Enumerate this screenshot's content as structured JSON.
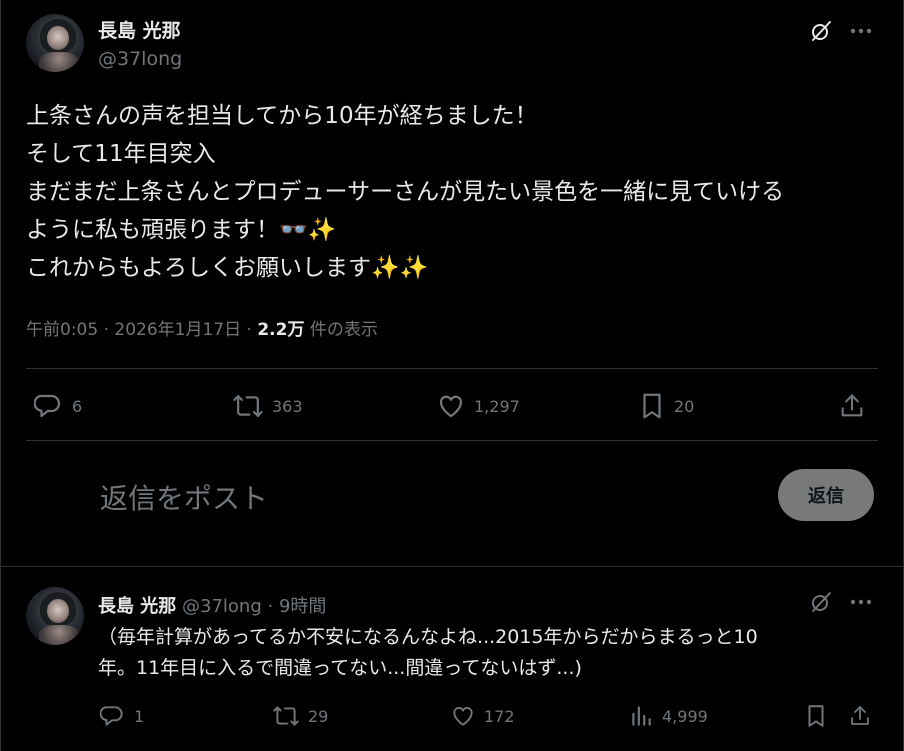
{
  "main_post": {
    "author_name": "長島 光那",
    "author_handle": "@37long",
    "text_lines": [
      "上条さんの声を担当してから10年が経ちました！",
      "そして11年目突入",
      "まだまだ上条さんとプロデューサーさんが見たい景色を一緒に見ていける",
      "ように私も頑張ります！👓✨",
      "これからもよろしくお願いします✨✨"
    ],
    "time": "午前0:05",
    "separator": "·",
    "date": "2026年1月17日",
    "views_count": "2.2万",
    "views_label": "件の表示",
    "stats": {
      "replies": "6",
      "reposts": "363",
      "likes": "1,297",
      "bookmarks": "20"
    }
  },
  "composer": {
    "placeholder": "返信をポスト",
    "button_label": "返信"
  },
  "reply_post": {
    "author_name": "長島 光那",
    "author_handle": "@37long",
    "separator": "·",
    "time": "9時間",
    "text_lines": [
      "（毎年計算があってるか不安になるんなよね...2015年からだからまるっと10",
      "年。11年目に入るで間違ってない...間違ってないはず...)"
    ],
    "stats": {
      "replies": "1",
      "reposts": "29",
      "likes": "172",
      "views": "4,999"
    }
  },
  "colors": {
    "background": "#000000",
    "text": "#e7e9ea",
    "muted": "#71767b",
    "divider": "#2f3336",
    "button": "#787a7a"
  },
  "icons": [
    "grok-icon",
    "more-icon",
    "reply-icon",
    "repost-icon",
    "like-icon",
    "bookmark-icon",
    "share-icon",
    "views-icon"
  ]
}
